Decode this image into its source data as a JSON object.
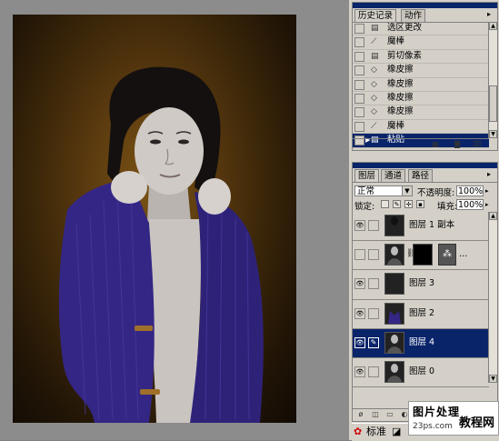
{
  "history_panel": {
    "tabs": [
      "历史记录",
      "动作"
    ],
    "menu_arrow": "▸",
    "items": [
      {
        "label": "选区更改",
        "icon": "document-icon"
      },
      {
        "label": "魔棒",
        "icon": "magic-wand-icon"
      },
      {
        "label": "剪切像素",
        "icon": "document-icon"
      },
      {
        "label": "橡皮擦",
        "icon": "eraser-icon"
      },
      {
        "label": "橡皮擦",
        "icon": "eraser-icon"
      },
      {
        "label": "橡皮擦",
        "icon": "eraser-icon"
      },
      {
        "label": "橡皮擦",
        "icon": "eraser-icon"
      },
      {
        "label": "魔棒",
        "icon": "magic-wand-icon"
      },
      {
        "label": "粘贴",
        "icon": "document-icon",
        "selected": true
      }
    ]
  },
  "layers_panel": {
    "tabs": [
      "图层",
      "通道",
      "路径"
    ],
    "menu_arrow": "▸",
    "blend_mode": "正常",
    "opacity_label": "不透明度:",
    "opacity_value": "100%",
    "lock_label": "锁定:",
    "fill_label": "填充:",
    "fill_value": "100%",
    "layers": [
      {
        "name": "图层 1 副本",
        "visible": true,
        "thumb": "girl-cutout"
      },
      {
        "name": "…",
        "visible": false,
        "thumb": "girl-dark",
        "has_mask": true
      },
      {
        "name": "图层 3",
        "visible": true,
        "thumb": "transparent"
      },
      {
        "name": "图层 2",
        "visible": true,
        "thumb": "coat"
      },
      {
        "name": "图层 4",
        "visible": true,
        "thumb": "girl-dark",
        "selected": true
      },
      {
        "name": "图层 0",
        "visible": true,
        "thumb": "girl-dark"
      }
    ]
  },
  "status_bar": {
    "mode_label": "标准"
  },
  "watermark": {
    "line1": "图片处理",
    "line2": "教程网",
    "line3": "23ps.com"
  },
  "colors": {
    "selection": "#0a246a",
    "panel_bg": "#d4d0c8",
    "coat": "#3a2a8a"
  }
}
